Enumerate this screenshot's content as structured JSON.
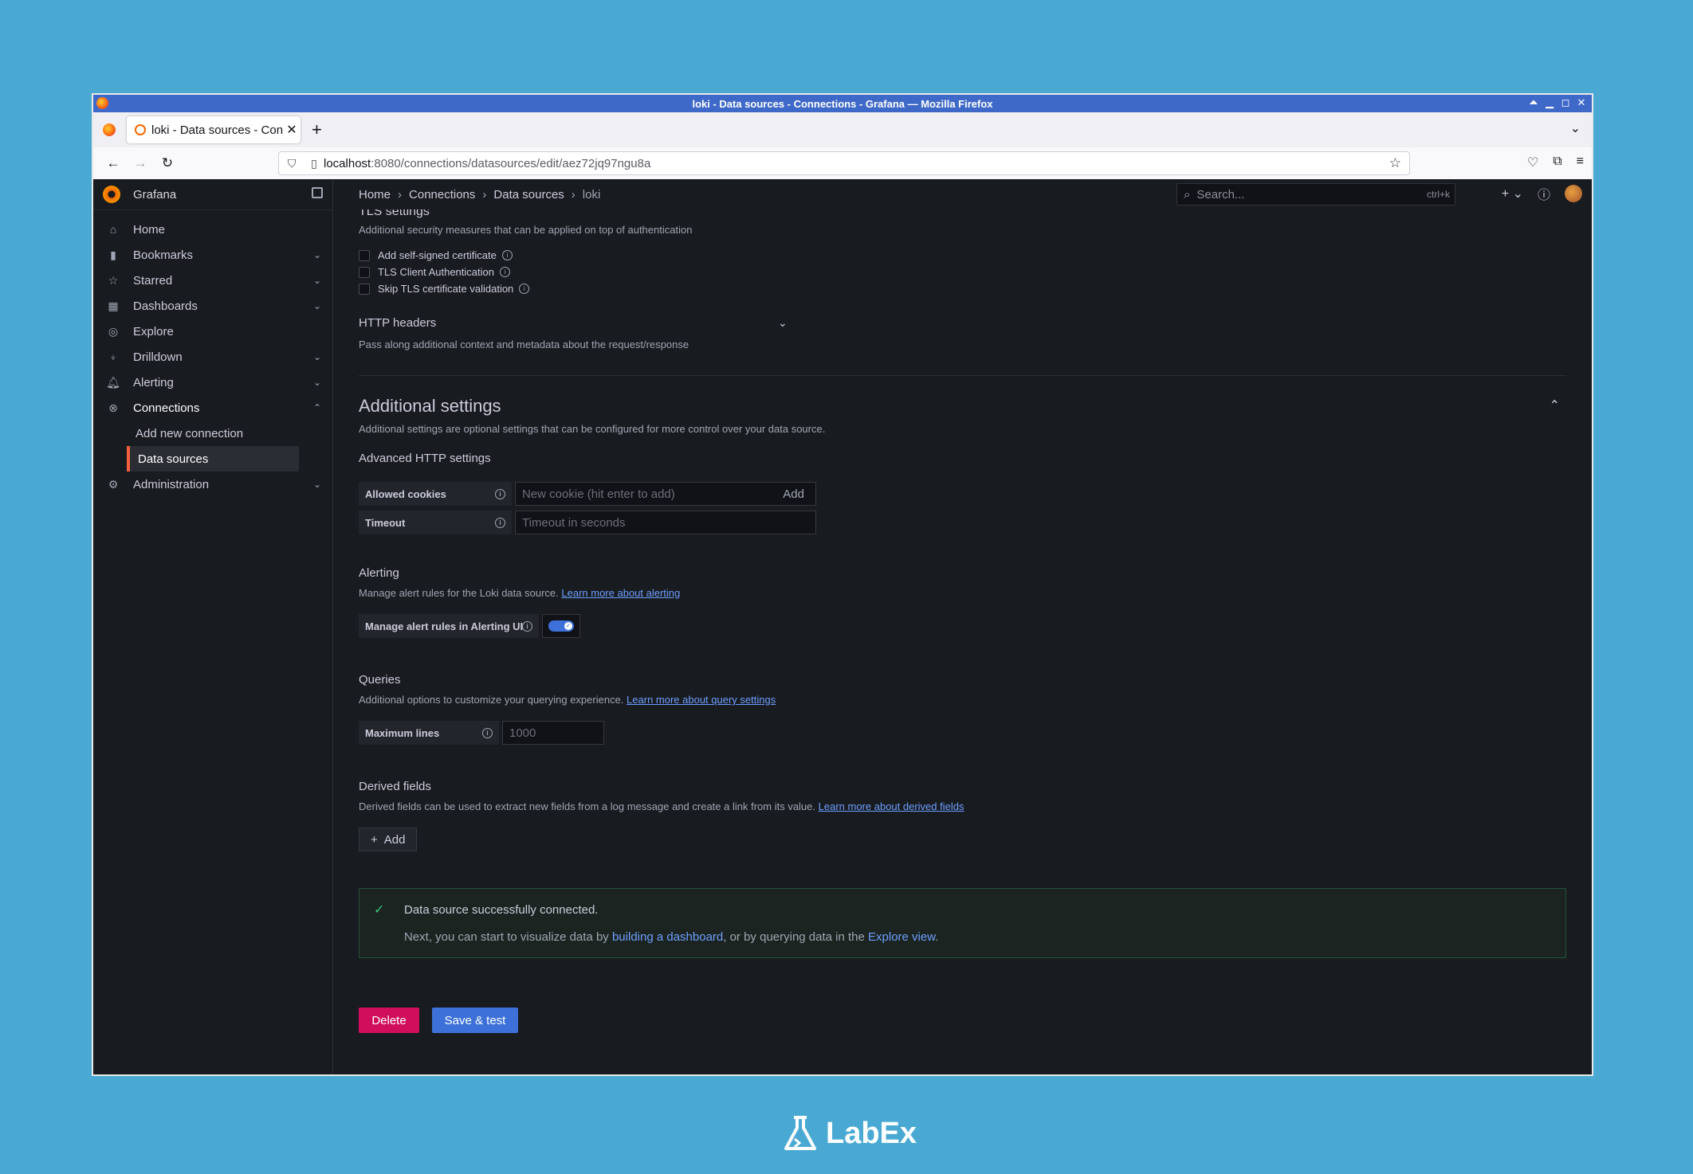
{
  "window": {
    "title": "loki - Data sources - Connections - Grafana — Mozilla Firefox"
  },
  "browser": {
    "tab_title": "loki - Data sources - Con",
    "url_host": "localhost",
    "url_path": ":8080/connections/datasources/edit/aez72jq97ngu8a"
  },
  "app": {
    "name": "Grafana",
    "breadcrumb": [
      "Home",
      "Connections",
      "Data sources",
      "loki"
    ],
    "search_placeholder": "Search...",
    "search_shortcut": "ctrl+k"
  },
  "sidebar": {
    "items": [
      {
        "label": "Home",
        "icon": "home-icon"
      },
      {
        "label": "Bookmarks",
        "icon": "bookmark-icon"
      },
      {
        "label": "Starred",
        "icon": "star-icon"
      },
      {
        "label": "Dashboards",
        "icon": "apps-icon"
      },
      {
        "label": "Explore",
        "icon": "compass-icon"
      },
      {
        "label": "Drilldown",
        "icon": "drilldown-icon"
      },
      {
        "label": "Alerting",
        "icon": "bell-icon"
      },
      {
        "label": "Connections",
        "icon": "connections-icon"
      },
      {
        "label": "Administration",
        "icon": "cog-icon"
      }
    ],
    "sub_items": [
      "Add new connection",
      "Data sources"
    ]
  },
  "tls": {
    "title": "TLS settings",
    "desc": "Additional security measures that can be applied on top of authentication",
    "options": [
      "Add self-signed certificate",
      "TLS Client Authentication",
      "Skip TLS certificate validation"
    ]
  },
  "http_headers": {
    "title": "HTTP headers",
    "desc": "Pass along additional context and metadata about the request/response"
  },
  "additional": {
    "title": "Additional settings",
    "desc": "Additional settings are optional settings that can be configured for more control over your data source.",
    "advanced_http": "Advanced HTTP settings",
    "allowed_cookies_label": "Allowed cookies",
    "allowed_cookies_placeholder": "New cookie (hit enter to add)",
    "add_label": "Add",
    "timeout_label": "Timeout",
    "timeout_placeholder": "Timeout in seconds"
  },
  "alerting": {
    "title": "Alerting",
    "desc": "Manage alert rules for the Loki data source.",
    "link": "Learn more about alerting",
    "toggle_label": "Manage alert rules in Alerting UI",
    "toggle_on": true
  },
  "queries": {
    "title": "Queries",
    "desc": "Additional options to customize your querying experience.",
    "link": "Learn more about query settings",
    "max_lines_label": "Maximum lines",
    "max_lines_placeholder": "1000"
  },
  "derived": {
    "title": "Derived fields",
    "desc": "Derived fields can be used to extract new fields from a log message and create a link from its value.",
    "link": "Learn more about derived fields",
    "add_label": "Add"
  },
  "status": {
    "title": "Data source successfully connected.",
    "body_pre": "Next, you can start to visualize data by ",
    "link1": "building a dashboard",
    "body_mid": ", or by querying data in the ",
    "link2": "Explore view",
    "body_post": "."
  },
  "actions": {
    "delete": "Delete",
    "save": "Save & test"
  },
  "footer": {
    "brand": "LabEx"
  },
  "colors": {
    "accent": "#3d71d9",
    "danger": "#d10e5c",
    "success": "#3cc278",
    "bg": "#181b1f",
    "desktop": "#4aa9d3"
  }
}
